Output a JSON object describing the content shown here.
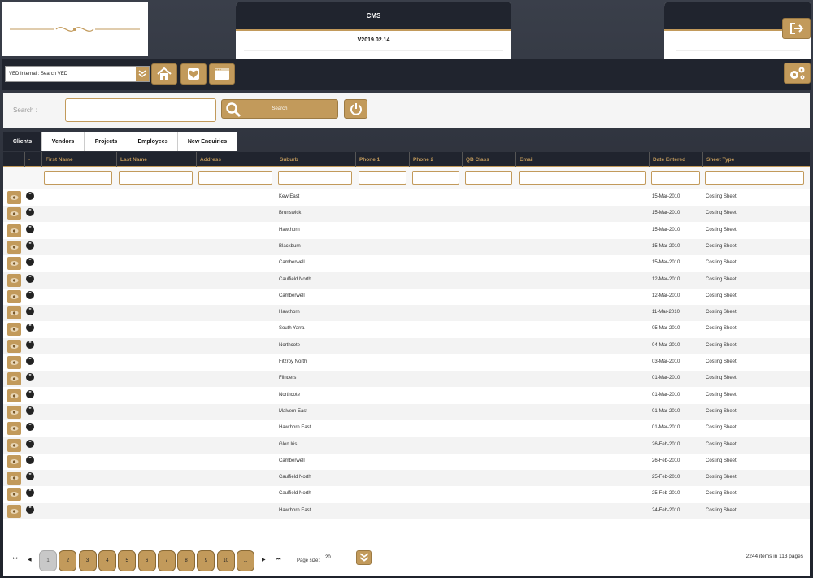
{
  "header": {
    "cms_title": "CMS",
    "version": "V2019.02.14"
  },
  "toolbar": {
    "context_select": "VED Internal : Search VED"
  },
  "search": {
    "label": "Search :",
    "input_value": "",
    "button_label": "Search"
  },
  "tabs": [
    "Clients",
    "Vendors",
    "Projects",
    "Employees",
    "New Enquiries"
  ],
  "grid": {
    "columns": [
      "First Name",
      "Last Name",
      "Address",
      "Suburb",
      "Phone 1",
      "Phone 2",
      "QB Class",
      "Email",
      "Date Entered",
      "Sheet Type"
    ],
    "sort_indicator": "-",
    "rows": [
      {
        "suburb": "Kew East",
        "date": "15-Mar-2010",
        "sheet": "Costing Sheet"
      },
      {
        "suburb": "Brunswick",
        "date": "15-Mar-2010",
        "sheet": "Costing Sheet"
      },
      {
        "suburb": "Hawthorn",
        "date": "15-Mar-2010",
        "sheet": "Costing Sheet"
      },
      {
        "suburb": "Blackburn",
        "date": "15-Mar-2010",
        "sheet": "Costing Sheet"
      },
      {
        "suburb": "Camberwell",
        "date": "15-Mar-2010",
        "sheet": "Costing Sheet"
      },
      {
        "suburb": "Caulfield North",
        "date": "12-Mar-2010",
        "sheet": "Costing Sheet"
      },
      {
        "suburb": "Camberwell",
        "date": "12-Mar-2010",
        "sheet": "Costing Sheet"
      },
      {
        "suburb": "Hawthorn",
        "date": "11-Mar-2010",
        "sheet": "Costing Sheet"
      },
      {
        "suburb": "South Yarra",
        "date": "05-Mar-2010",
        "sheet": "Costing Sheet"
      },
      {
        "suburb": "Northcote",
        "date": "04-Mar-2010",
        "sheet": "Costing Sheet"
      },
      {
        "suburb": "Fitzroy North",
        "date": "03-Mar-2010",
        "sheet": "Costing Sheet"
      },
      {
        "suburb": "Flinders",
        "date": "01-Mar-2010",
        "sheet": "Costing Sheet"
      },
      {
        "suburb": "Northcote",
        "date": "01-Mar-2010",
        "sheet": "Costing Sheet"
      },
      {
        "suburb": "Malvern East",
        "date": "01-Mar-2010",
        "sheet": "Costing Sheet"
      },
      {
        "suburb": "Hawthorn East",
        "date": "01-Mar-2010",
        "sheet": "Costing Sheet"
      },
      {
        "suburb": "Glen Iris",
        "date": "26-Feb-2010",
        "sheet": "Costing Sheet"
      },
      {
        "suburb": "Camberwell",
        "date": "26-Feb-2010",
        "sheet": "Costing Sheet"
      },
      {
        "suburb": "Caulfield North",
        "date": "25-Feb-2010",
        "sheet": "Costing Sheet"
      },
      {
        "suburb": "Caulfield North",
        "date": "25-Feb-2010",
        "sheet": "Costing Sheet"
      },
      {
        "suburb": "Hawthorn East",
        "date": "24-Feb-2010",
        "sheet": "Costing Sheet"
      }
    ]
  },
  "pager": {
    "first": "⏮",
    "prev": "◀",
    "next": "▶",
    "last": "⏭",
    "pages": [
      "1",
      "2",
      "3",
      "4",
      "5",
      "6",
      "7",
      "8",
      "9",
      "10",
      "..."
    ],
    "current_page": "1",
    "page_size_label": "Page size:",
    "page_size": "20",
    "info": "2244 items in 113 pages"
  },
  "colors": {
    "accent": "#c29a5b",
    "dark": "#20242e"
  },
  "icons": [
    "logout-icon",
    "home-icon",
    "heart-icon",
    "window-icon",
    "settings-icon",
    "search-icon",
    "power-icon",
    "eye-icon",
    "quote-icon",
    "chevron-down-icon"
  ]
}
